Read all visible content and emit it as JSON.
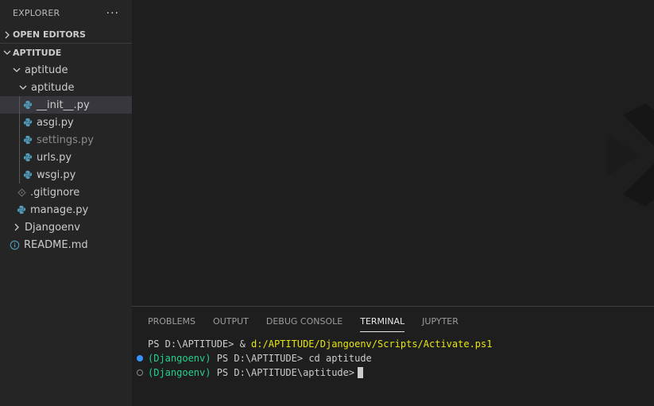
{
  "explorer": {
    "title": "EXPLORER",
    "more": "···",
    "open_editors": "OPEN EDITORS",
    "workspace": "APTITUDE",
    "tree": {
      "root_folder": "aptitude",
      "sub_folder": "aptitude",
      "files": [
        "__init__.py",
        "asgi.py",
        "settings.py",
        "urls.py",
        "wsgi.py"
      ],
      "gitignore": ".gitignore",
      "manage": "manage.py",
      "djangoenv": "Djangoenv",
      "readme": "README.md"
    }
  },
  "panel": {
    "tabs": [
      "PROBLEMS",
      "OUTPUT",
      "DEBUG CONSOLE",
      "TERMINAL",
      "JUPYTER"
    ],
    "active_tab": "TERMINAL",
    "terminal": {
      "line1_prompt": "PS D:\\APTITUDE> & ",
      "line1_cmd": "d:/APTITUDE/Djangoenv/Scripts/Activate.ps1",
      "line2_env": "(Djangoenv)",
      "line2_prompt": " PS D:\\APTITUDE> ",
      "line2_cmd": "cd aptitude",
      "line3_env": "(Djangoenv)",
      "line3_prompt": " PS D:\\APTITUDE\\aptitude>"
    }
  },
  "colors": {
    "python_icon": "#519aba",
    "terminal_yellow": "#e5e510",
    "terminal_green": "#23d18b",
    "decoration_blue": "#3794ff"
  }
}
